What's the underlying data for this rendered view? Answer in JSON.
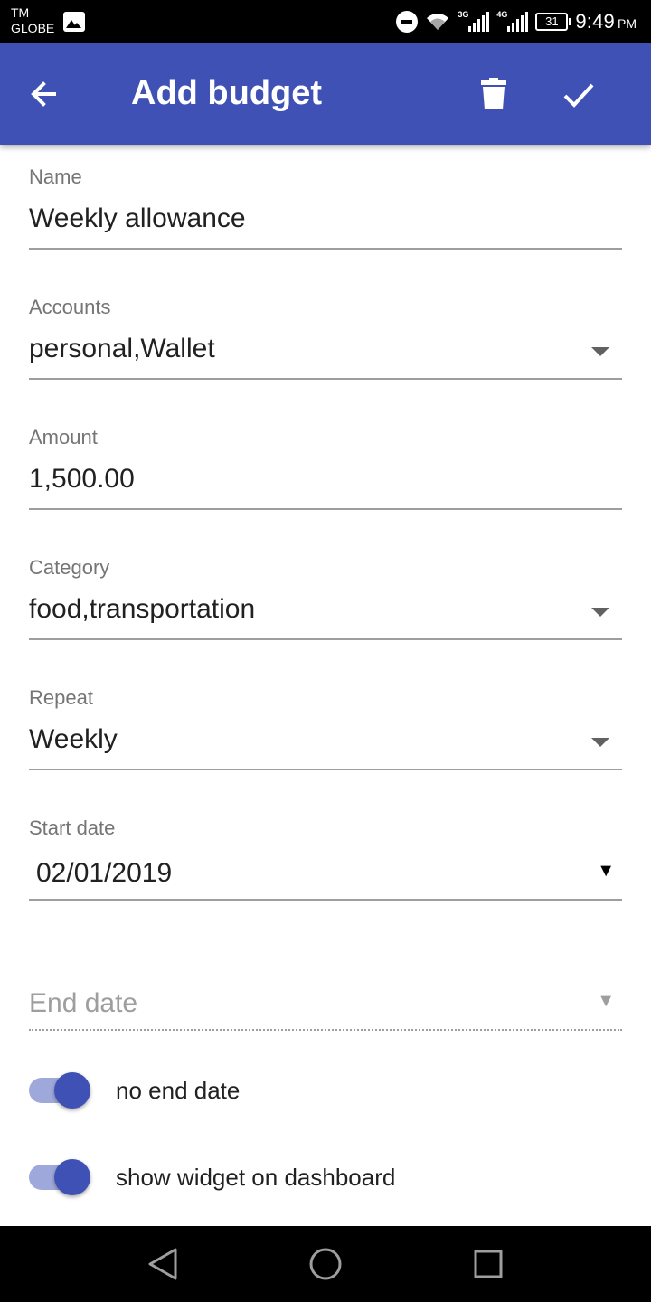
{
  "status_bar": {
    "carrier_line1": "TM",
    "carrier_line2": "GLOBE",
    "net1": "3G",
    "net2": "4G",
    "battery": "31",
    "time": "9:49",
    "ampm": "PM"
  },
  "app_bar": {
    "title": "Add budget",
    "color": "#3f51b5",
    "icons": [
      "arrow-back-icon",
      "delete-icon",
      "check-icon"
    ]
  },
  "form": {
    "name_label": "Name",
    "name_value": "Weekly allowance",
    "accounts_label": "Accounts",
    "accounts_value": "personal,Wallet",
    "amount_label": "Amount",
    "amount_value": "1,500.00",
    "category_label": "Category",
    "category_value": "food,transportation",
    "repeat_label": "Repeat",
    "repeat_value": "Weekly",
    "start_date_label": "Start date",
    "start_date_value": "02/01/2019",
    "end_date_placeholder": "End date"
  },
  "toggles": {
    "no_end_date_label": "no end date",
    "no_end_date_on": true,
    "show_widget_label": "show widget on dashboard",
    "show_widget_on": true
  },
  "nav": {
    "icons": [
      "back-triangle-icon",
      "home-circle-icon",
      "recents-square-icon"
    ]
  }
}
